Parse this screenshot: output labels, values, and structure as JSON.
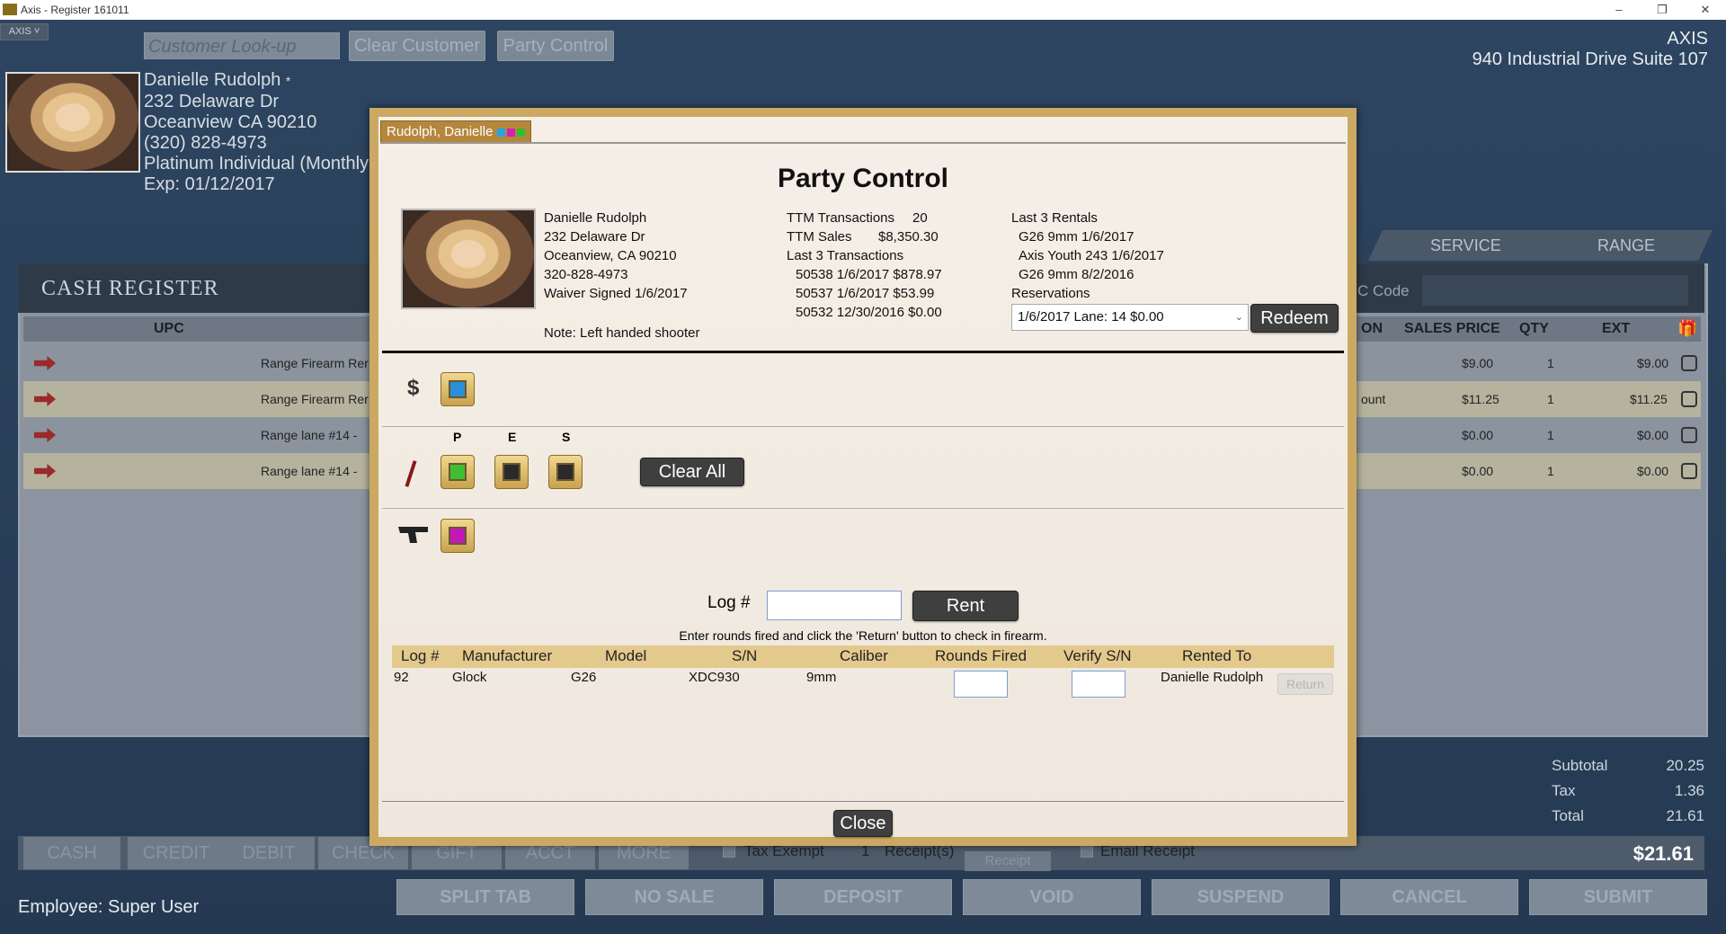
{
  "titlebar": {
    "title": "Axis - Register  161011",
    "min": "–",
    "restore": "❐",
    "close": "✕"
  },
  "app": {
    "axis_menu": "AXIS ˅",
    "customer_lookup_placeholder": "Customer Look-up",
    "clear_customer": "Clear Customer",
    "party_control": "Party Control",
    "company": {
      "name": "AXIS",
      "address": "940 Industrial Drive Suite 107"
    },
    "customer": {
      "name": "Danielle Rudolph",
      "star": "*",
      "street": "232 Delaware Dr",
      "city": "Oceanview CA 90210",
      "phone": "(320) 828-4973",
      "plan": "Platinum Individual (Monthly",
      "exp": "Exp: 01/12/2017"
    },
    "register_title": "CASH REGISTER",
    "tabs": {
      "service": "SERVICE",
      "range": "RANGE"
    },
    "code_label": "C Code",
    "columns": {
      "upc": "UPC",
      "discount": "ON",
      "sales_price": "SALES PRICE",
      "qty": "QTY",
      "ext": "EXT"
    },
    "rows": [
      {
        "desc": "Range Firearm Rer",
        "extra": "",
        "price": "$9.00",
        "qty": "1",
        "ext": "$9.00"
      },
      {
        "desc": "Range Firearm Rer",
        "extra": "ount",
        "price": "$11.25",
        "qty": "1",
        "ext": "$11.25"
      },
      {
        "desc": "Range lane #14 -",
        "extra": "",
        "price": "$0.00",
        "qty": "1",
        "ext": "$0.00"
      },
      {
        "desc": "Range lane #14 -",
        "extra": "",
        "price": "$0.00",
        "qty": "1",
        "ext": "$0.00"
      }
    ],
    "totals": {
      "subtotal_label": "Subtotal",
      "subtotal": "20.25",
      "tax_label": "Tax",
      "tax": "1.36",
      "total_label": "Total",
      "total": "21.61",
      "big_total": "$21.61"
    },
    "pay_buttons": [
      "CASH",
      "CREDIT",
      "DEBIT",
      "CHECK",
      "GIFT",
      "ACCT",
      "MORE"
    ],
    "options": {
      "tax_exempt": "Tax Exempt",
      "receipts_count": "1",
      "receipts": "Receipt(s)",
      "receipt_btn": "Receipt",
      "email_receipt": "Email Receipt"
    },
    "bottom_buttons": [
      "SPLIT TAB",
      "NO SALE",
      "DEPOSIT",
      "VOID",
      "SUSPEND",
      "CANCEL",
      "SUBMIT"
    ],
    "employee": "Employee: Super User"
  },
  "modal": {
    "tab_label": "Rudolph, Danielle",
    "tab_colors": [
      "#29a3e6",
      "#d61fb4",
      "#2ec02e"
    ],
    "title": "Party Control",
    "customer_lines": [
      "Danielle Rudolph",
      "232 Delaware Dr",
      "Oceanview, CA 90210",
      "320-828-4973",
      "Waiver Signed 1/6/2017"
    ],
    "note": "Note: Left handed shooter",
    "stats": {
      "ttm_transactions_label": "TTM Transactions",
      "ttm_transactions": "20",
      "ttm_sales_label": "TTM Sales",
      "ttm_sales": "$8,350.30",
      "last3_label": "Last 3 Transactions",
      "transactions": [
        "50538 1/6/2017 $878.97",
        "50537 1/6/2017 $53.99",
        "50532 12/30/2016 $0.00"
      ]
    },
    "rentals": {
      "label": "Last 3 Rentals",
      "items": [
        "G26 9mm 1/6/2017",
        "Axis Youth 243 1/6/2017",
        "G26 9mm 8/2/2016"
      ],
      "reservations_label": "Reservations",
      "reservation_selected": "1/6/2017  Lane: 14 $0.00",
      "redeem": "Redeem"
    },
    "money_icon": "$",
    "money_color": "#2a8fd8",
    "pes_labels": [
      "P",
      "E",
      "S"
    ],
    "pes_colors": [
      "#3fbf2f",
      "#2a2a2a",
      "#2a2a2a"
    ],
    "clear_all": "Clear All",
    "gun_color": "#c318b8",
    "log_label": "Log #",
    "log_value": "",
    "rent": "Rent",
    "instruction": "Enter rounds fired and click the 'Return' button to check in firearm.",
    "grid_headers": [
      "Log #",
      "Manufacturer",
      "Model",
      "S/N",
      "Caliber",
      "Rounds Fired",
      "Verify S/N",
      "Rented To"
    ],
    "grid_rows": [
      {
        "log": "92",
        "manufacturer": "Glock",
        "model": "G26",
        "sn": "XDC930",
        "caliber": "9mm",
        "rounds": "",
        "verify": "",
        "rented_to": "Danielle Rudolph",
        "return": "Return"
      }
    ],
    "close": "Close"
  }
}
